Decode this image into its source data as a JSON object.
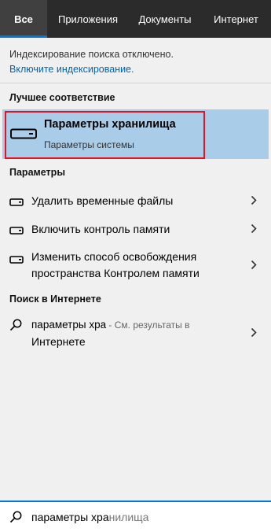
{
  "tabs": [
    {
      "label": "Все"
    },
    {
      "label": "Приложения"
    },
    {
      "label": "Документы"
    },
    {
      "label": "Интернет"
    }
  ],
  "notice": {
    "text": "Индексирование поиска отключено.",
    "link": "Включите индексирование."
  },
  "best_match": {
    "section_title": "Лучшее соответствие",
    "title": "Параметры хранилища",
    "subtitle": "Параметры системы",
    "icon": "drive-icon"
  },
  "settings": {
    "section_title": "Параметры",
    "items": [
      {
        "label": "Удалить временные файлы",
        "icon": "drive-icon"
      },
      {
        "label": "Включить контроль памяти",
        "icon": "drive-icon"
      },
      {
        "label_line1": "Изменить способ освобождения",
        "label_line2": "пространства Контролем памяти",
        "icon": "drive-icon"
      }
    ]
  },
  "web": {
    "section_title": "Поиск в Интернете",
    "query": "параметры хра",
    "suffix": " - См. результаты в",
    "suffix_line2": "Интернете",
    "icon": "search-icon"
  },
  "searchbar": {
    "typed": "параметры хра",
    "completion": "нилища",
    "icon": "search-icon"
  },
  "colors": {
    "accent": "#0078d7",
    "highlight": "#a9cce8",
    "annotation_box": "#e81123",
    "tabbar": "#2b2b2b"
  }
}
